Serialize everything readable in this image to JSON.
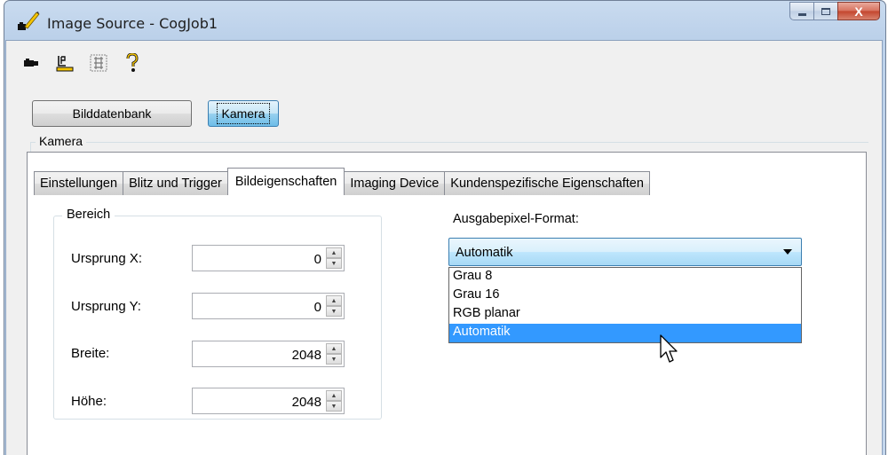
{
  "window": {
    "title": "Image Source - CogJob1",
    "buttons": {
      "minimize": "minimize-icon",
      "maximize": "maximize-icon",
      "close": "X"
    }
  },
  "toolbar": {
    "icons": [
      "camera-icon",
      "text-tool-icon",
      "region-grid-icon",
      "help-icon"
    ]
  },
  "source_buttons": {
    "database": "Bilddatenbank",
    "camera": "Kamera",
    "active": "camera"
  },
  "group": {
    "label": "Kamera"
  },
  "tabs": [
    {
      "label": "Einstellungen",
      "selected": false
    },
    {
      "label": "Blitz und Trigger",
      "selected": false
    },
    {
      "label": "Bildeigenschaften",
      "selected": true
    },
    {
      "label": "Imaging Device",
      "selected": false
    },
    {
      "label": "Kundenspezifische Eigenschaften",
      "selected": false
    }
  ],
  "bereich": {
    "label": "Bereich",
    "fields": [
      {
        "label": "Ursprung X:",
        "value": "0"
      },
      {
        "label": "Ursprung Y:",
        "value": "0"
      },
      {
        "label": "Breite:",
        "value": "2048"
      },
      {
        "label": "Höhe:",
        "value": "2048"
      }
    ]
  },
  "format": {
    "label": "Ausgabepixel-Format:",
    "selected": "Automatik",
    "options": [
      "Grau 8",
      "Grau 16",
      "RGB planar",
      "Automatik"
    ],
    "highlighted_index": 3
  },
  "colors": {
    "selection": "#3399ff",
    "combo_border": "#3c7fb1",
    "window_frame": "#c3d6ec"
  }
}
